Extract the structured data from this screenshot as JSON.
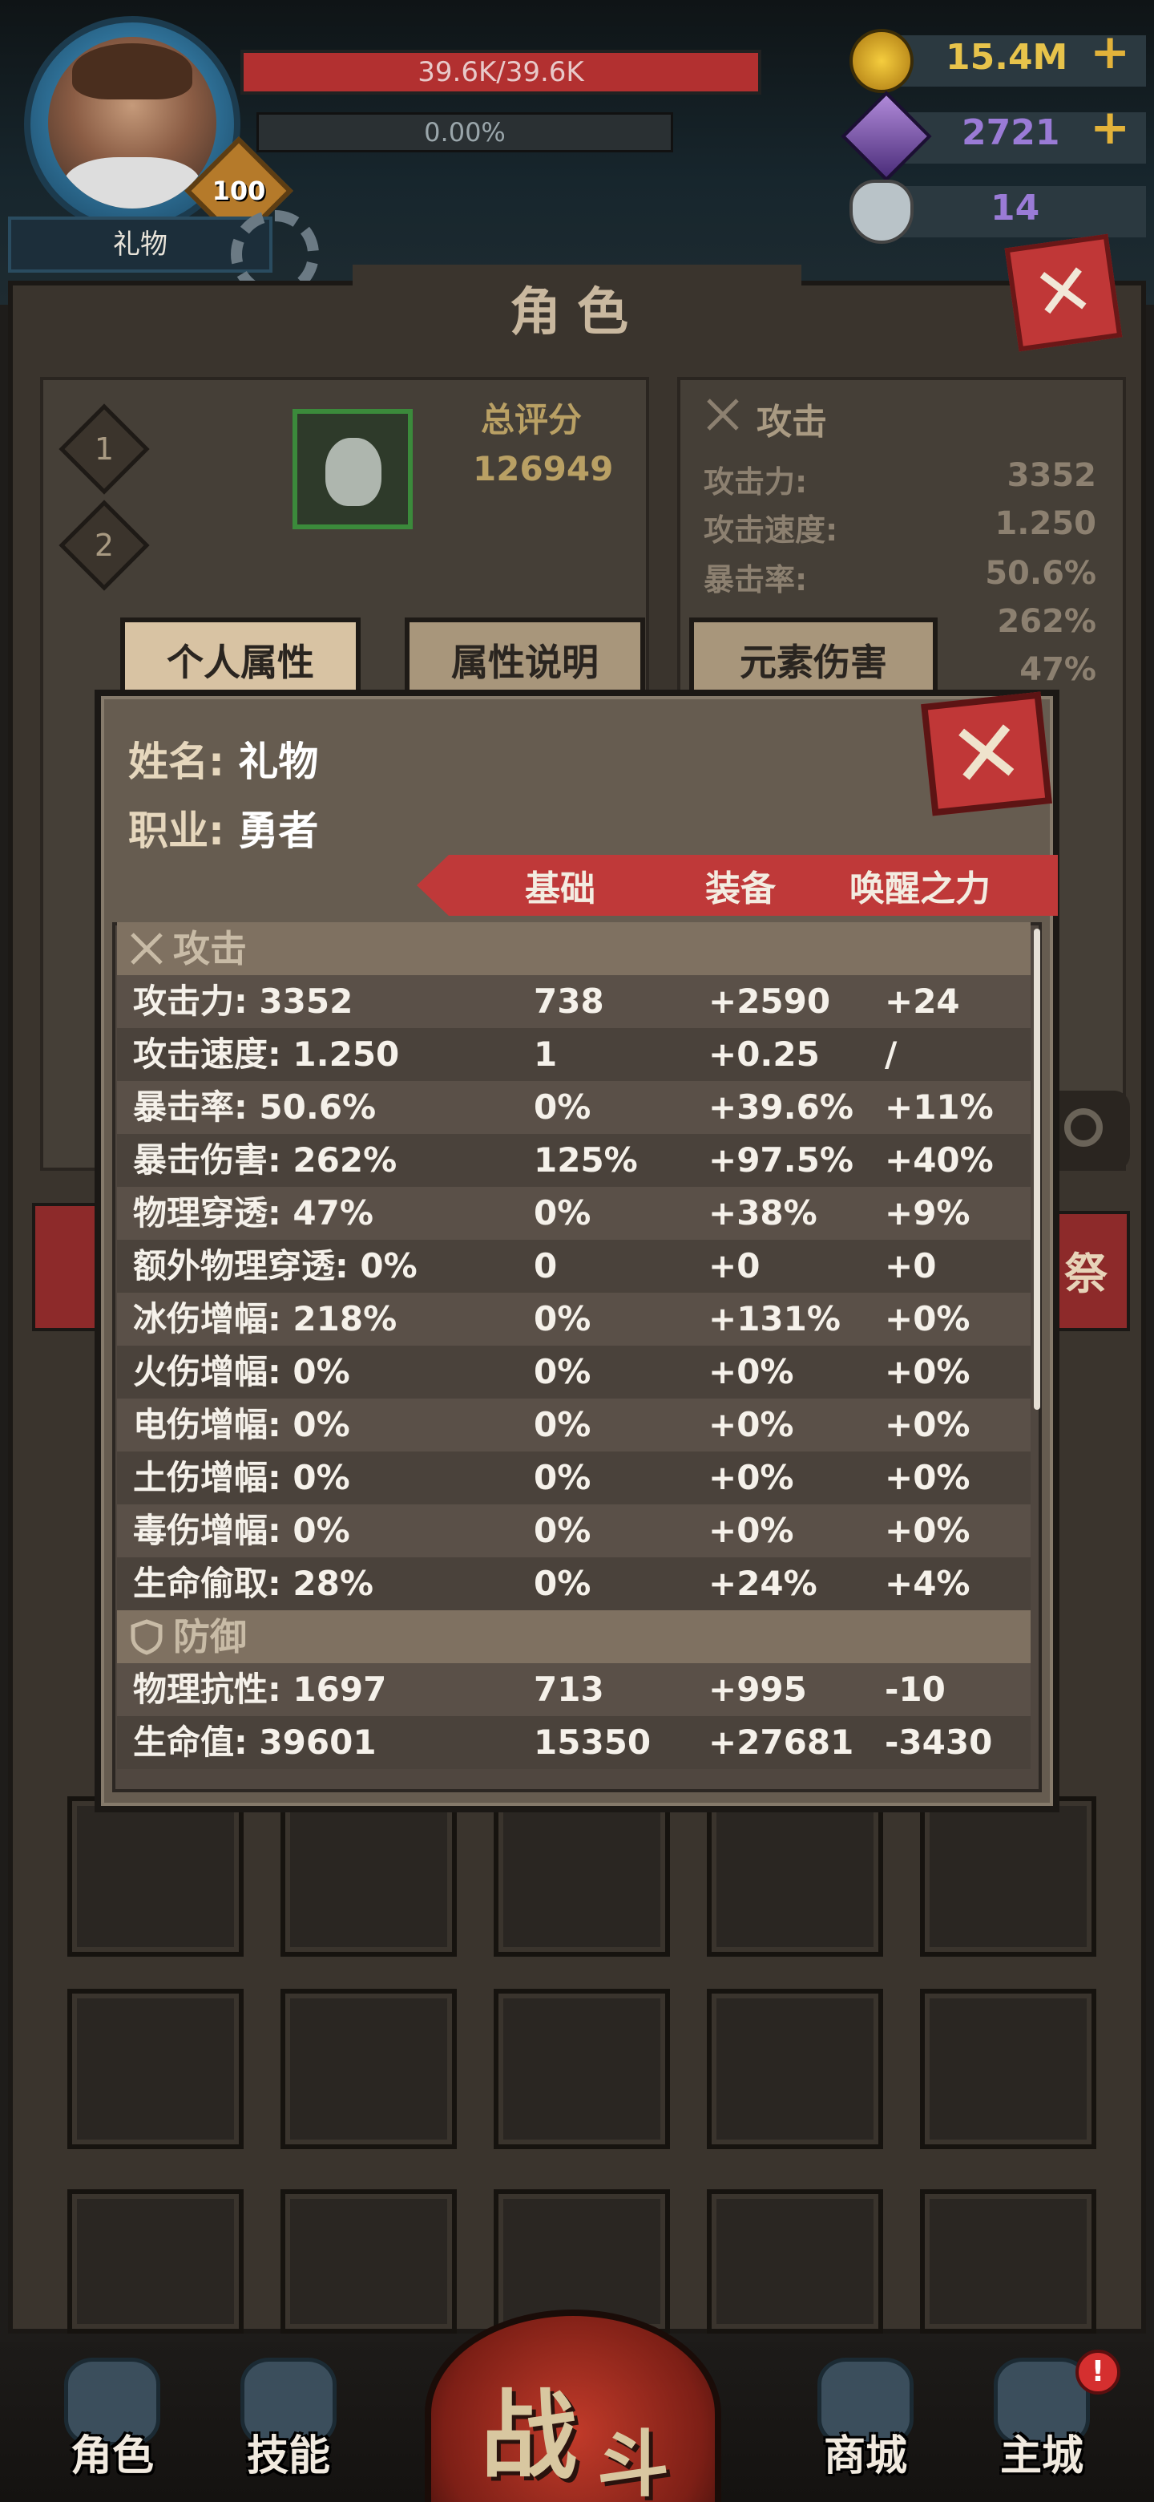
{
  "hud": {
    "hp": "39.6K/39.6K",
    "exp": "0.00%",
    "level": "100",
    "player_name": "礼物",
    "gold": "15.4M",
    "gems": "2721",
    "skulls": "14",
    "plus": "+"
  },
  "panel": {
    "title": "角色",
    "close": "✕",
    "slot1": "1",
    "slot2": "2",
    "score_label": "总评分",
    "score_value": "126949",
    "side_section": "攻击",
    "side_stats": [
      {
        "label": "攻击力:",
        "value": "3352"
      },
      {
        "label": "攻击速度:",
        "value": "1.250"
      },
      {
        "label": "暴击率:",
        "value": "50.6%"
      },
      {
        "label": "",
        "value": "262%"
      },
      {
        "label": "",
        "value": "47%"
      }
    ],
    "right_tag": "祭"
  },
  "tabs": [
    "个人属性",
    "属性说明",
    "元素伤害"
  ],
  "modal": {
    "close": "✕",
    "name_label": "姓名:",
    "name_value": "礼物",
    "job_label": "职业:",
    "job_value": "勇者",
    "columns": [
      "基础",
      "装备",
      "唤醒之力"
    ],
    "attack_section": "攻击",
    "defense_section": "防御",
    "attack_rows": [
      [
        "攻击力: 3352",
        "738",
        "+2590",
        "+24"
      ],
      [
        "攻击速度: 1.250",
        "1",
        "+0.25",
        "/"
      ],
      [
        "暴击率: 50.6%",
        "0%",
        "+39.6%",
        "+11%"
      ],
      [
        "暴击伤害: 262%",
        "125%",
        "+97.5%",
        "+40%"
      ],
      [
        "物理穿透: 47%",
        "0%",
        "+38%",
        "+9%"
      ],
      [
        "额外物理穿透: 0%",
        "0",
        "+0",
        "+0"
      ],
      [
        "冰伤增幅: 218%",
        "0%",
        "+131%",
        "+0%"
      ],
      [
        "火伤增幅: 0%",
        "0%",
        "+0%",
        "+0%"
      ],
      [
        "电伤增幅: 0%",
        "0%",
        "+0%",
        "+0%"
      ],
      [
        "土伤增幅: 0%",
        "0%",
        "+0%",
        "+0%"
      ],
      [
        "毒伤增幅: 0%",
        "0%",
        "+0%",
        "+0%"
      ],
      [
        "生命偷取: 28%",
        "0%",
        "+24%",
        "+4%"
      ]
    ],
    "defense_rows": [
      [
        "物理抗性: 1697",
        "713",
        "+995",
        "-10"
      ],
      [
        "生命值: 39601",
        "15350",
        "+27681",
        "-3430"
      ]
    ]
  },
  "nav": {
    "role": "角色",
    "skill": "技能",
    "battle_1": "战",
    "battle_2": "斗",
    "shop": "商城",
    "city": "主城",
    "notify": "!"
  },
  "colors": {
    "accent_red": "#bf3939",
    "gold": "#e7c34b",
    "gem": "#9a7bd6"
  }
}
